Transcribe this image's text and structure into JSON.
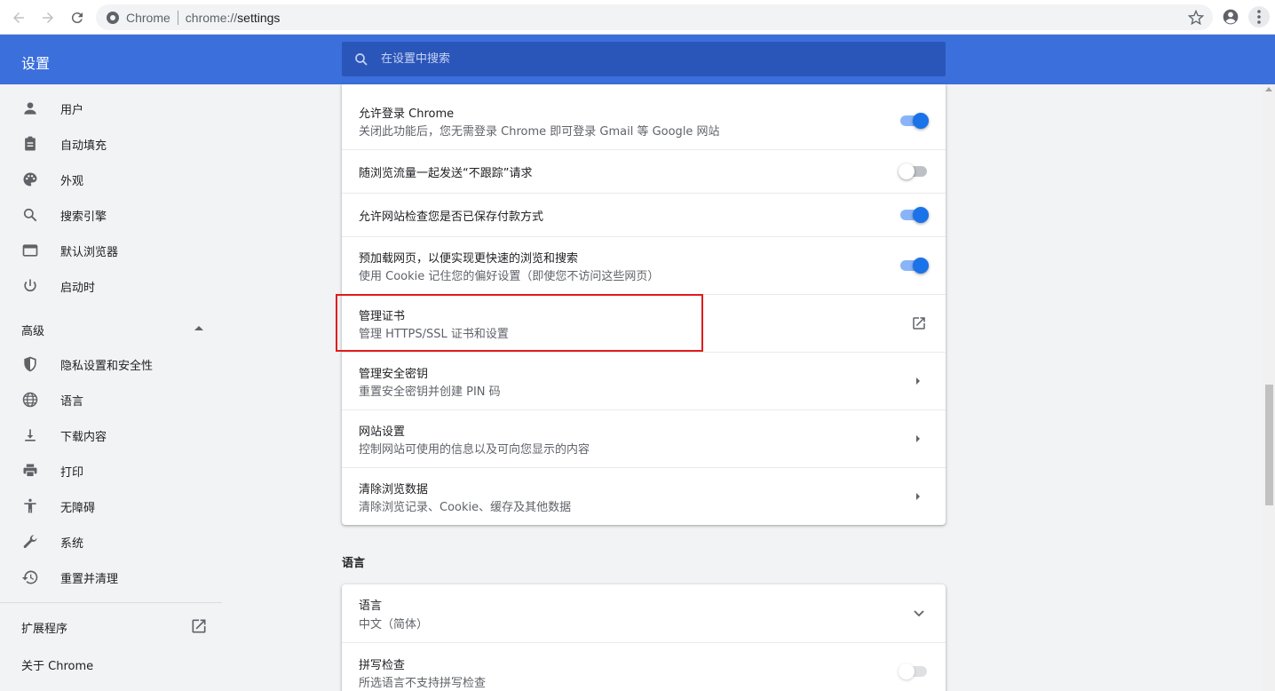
{
  "browser": {
    "brand": "Chrome",
    "url_prefix": "chrome://",
    "url_path": "settings"
  },
  "header": {
    "title": "设置",
    "search_placeholder": "在设置中搜索"
  },
  "sidebar": {
    "items": [
      {
        "label": "用户",
        "icon": "person-icon"
      },
      {
        "label": "自动填充",
        "icon": "clipboard-icon"
      },
      {
        "label": "外观",
        "icon": "palette-icon"
      },
      {
        "label": "搜索引擎",
        "icon": "search-icon"
      },
      {
        "label": "默认浏览器",
        "icon": "browser-window-icon"
      },
      {
        "label": "启动时",
        "icon": "power-icon"
      }
    ],
    "advanced_label": "高级",
    "advanced_items": [
      {
        "label": "隐私设置和安全性",
        "icon": "shield-icon"
      },
      {
        "label": "语言",
        "icon": "globe-icon"
      },
      {
        "label": "下载内容",
        "icon": "download-icon"
      },
      {
        "label": "打印",
        "icon": "printer-icon"
      },
      {
        "label": "无障碍",
        "icon": "accessibility-icon"
      },
      {
        "label": "系统",
        "icon": "wrench-icon"
      },
      {
        "label": "重置并清理",
        "icon": "history-icon"
      }
    ],
    "extensions_label": "扩展程序",
    "about_label": "关于 Chrome"
  },
  "privacy": {
    "rows": [
      {
        "title": "允许登录 Chrome",
        "subtitle": "关闭此功能后，您无需登录 Chrome 即可登录 Gmail 等 Google 网站",
        "control": "toggle",
        "on": true
      },
      {
        "title": "随浏览流量一起发送“不跟踪”请求",
        "subtitle": "",
        "control": "toggle",
        "on": false
      },
      {
        "title": "允许网站检查您是否已保存付款方式",
        "subtitle": "",
        "control": "toggle",
        "on": true
      },
      {
        "title": "预加载网页，以便实现更快速的浏览和搜索",
        "subtitle": "使用 Cookie 记住您的偏好设置（即使您不访问这些网页）",
        "control": "toggle",
        "on": true
      },
      {
        "title": "管理证书",
        "subtitle": "管理 HTTPS/SSL 证书和设置",
        "control": "external-link"
      },
      {
        "title": "管理安全密钥",
        "subtitle": "重置安全密钥并创建 PIN 码",
        "control": "arrow"
      },
      {
        "title": "网站设置",
        "subtitle": "控制网站可使用的信息以及可向您显示的内容",
        "control": "arrow"
      },
      {
        "title": "清除浏览数据",
        "subtitle": "清除浏览记录、Cookie、缓存及其他数据",
        "control": "arrow"
      }
    ]
  },
  "languages": {
    "section_title": "语言",
    "rows": [
      {
        "title": "语言",
        "subtitle": "中文（简体）",
        "control": "chevron-down"
      },
      {
        "title": "拼写检查",
        "subtitle": "所选语言不支持拼写检查",
        "control": "toggle",
        "on": false
      }
    ]
  },
  "colors": {
    "header_blue": "#3b6fdc",
    "toggle_on": "#1a73e8",
    "highlight_red": "#e11b1b"
  }
}
